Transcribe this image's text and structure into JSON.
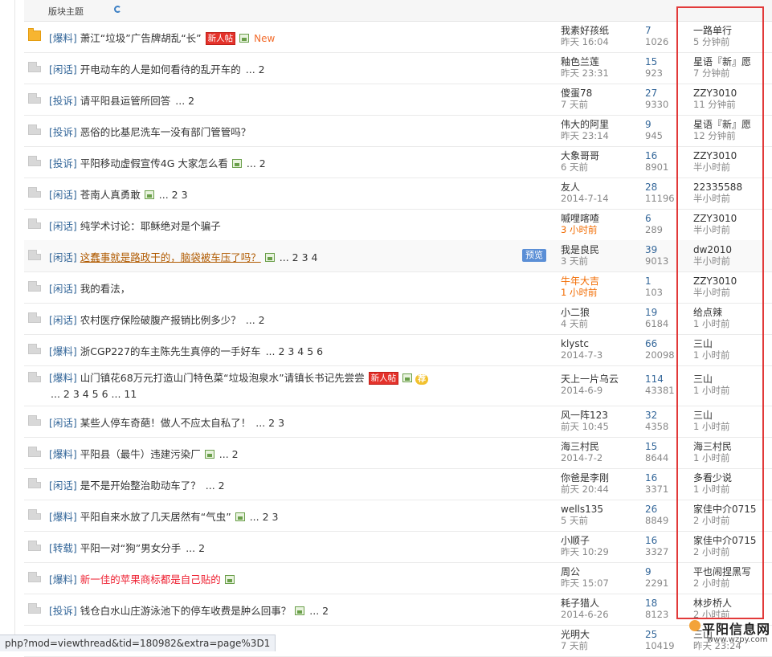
{
  "header": {
    "title": "版块主题"
  },
  "rows": [
    {
      "icon": "hot",
      "cat": "[爆料]",
      "title": "萧江“垃圾”广告牌胡乱“长”",
      "tags": [
        "newpost",
        "img",
        "newtext"
      ],
      "pages": "",
      "author": "我素好孩纸",
      "date": "昨天 16:04",
      "replies": "7",
      "views": "1026",
      "last_name": "一路单行",
      "last_time": "5 分钟前"
    },
    {
      "icon": "normal",
      "cat": "[闲话]",
      "title": "开电动车的人是如何看待的乱开车的",
      "tags": [],
      "pages": "... 2",
      "author": "釉色兰莲",
      "date": "昨天 23:31",
      "replies": "15",
      "views": "923",
      "last_name": "星语『新』愿",
      "last_time": "7 分钟前"
    },
    {
      "icon": "normal",
      "cat": "[投诉]",
      "title": "请平阳县运管所回答",
      "tags": [],
      "pages": "... 2",
      "author": "傻蛋78",
      "date": "7 天前",
      "replies": "27",
      "views": "9330",
      "last_name": "ZZY3010",
      "last_time": "11 分钟前"
    },
    {
      "icon": "normal",
      "cat": "[投诉]",
      "title": "恶俗的比基尼洗车一没有部门管管吗？",
      "tags": [],
      "pages": "",
      "author": "伟大的阿里",
      "date": "昨天 23:14",
      "replies": "9",
      "views": "945",
      "last_name": "星语『新』愿",
      "last_time": "12 分钟前"
    },
    {
      "icon": "normal",
      "cat": "[投诉]",
      "title": "平阳移动虚假宣传4G 大家怎么看",
      "tags": [
        "img"
      ],
      "pages": "... 2",
      "author": "大象哥哥",
      "date": "6 天前",
      "replies": "16",
      "views": "8901",
      "last_name": "ZZY3010",
      "last_time": "半小时前"
    },
    {
      "icon": "normal",
      "cat": "[闲话]",
      "title": "苍南人真勇敢",
      "tags": [
        "img"
      ],
      "pages": "... 2  3",
      "author": "友人",
      "date": "2014-7-14",
      "replies": "28",
      "views": "11196",
      "last_name": "22335588",
      "last_time": "半小时前"
    },
    {
      "icon": "normal",
      "cat": "[闲话]",
      "title": "纯学术讨论：耶稣绝对是个骗子",
      "tags": [],
      "pages": "",
      "author": "嘁哩喀喳",
      "date": "3 小时前",
      "date_orange": true,
      "replies": "6",
      "views": "289",
      "last_name": "ZZY3010",
      "last_time": "半小时前"
    },
    {
      "icon": "normal",
      "cat": "[闲话]",
      "title": "这蠢事就是路政干的，脑袋被车压了吗？",
      "style": "link",
      "tags": [
        "img"
      ],
      "pages": "... 2  3  4",
      "preview": "预览",
      "author": "我是良民",
      "date": "3 天前",
      "replies": "39",
      "views": "9013",
      "last_name": "dw2010",
      "last_time": "半小时前"
    },
    {
      "icon": "normal",
      "cat": "[闲话]",
      "title": "我的看法，",
      "tags": [],
      "pages": "",
      "author": "牛年大吉",
      "date": "1 小时前",
      "date_orange": true,
      "author_orange": true,
      "replies": "1",
      "views": "103",
      "last_name": "ZZY3010",
      "last_time": "半小时前"
    },
    {
      "icon": "normal",
      "cat": "[闲话]",
      "title": "农村医疗保险破腹产报销比例多少？",
      "tags": [],
      "pages": "... 2",
      "author": "小二狼",
      "date": "4 天前",
      "replies": "19",
      "views": "6184",
      "last_name": "给点辣",
      "last_time": "1 小时前"
    },
    {
      "icon": "normal",
      "cat": "[爆料]",
      "title": "浙CGP227的车主陈先生真停的一手好车",
      "tags": [],
      "pages": "... 2  3  4  5  6",
      "author": "klystc",
      "date": "2014-7-3",
      "replies": "66",
      "views": "20098",
      "last_name": "三山",
      "last_time": "1 小时前"
    },
    {
      "icon": "normal",
      "cat": "[爆料]",
      "title": "山门镇花68万元打造山门特色菜“垃圾泡泉水”请镇长书记先尝尝",
      "tags": [
        "newpost",
        "img",
        "rec"
      ],
      "pages2": "... 2  3  4  5  6 ... 11",
      "author": "天上一片乌云",
      "date": "2014-6-9",
      "replies": "114",
      "views": "43381",
      "last_name": "三山",
      "last_time": "1 小时前"
    },
    {
      "icon": "normal",
      "cat": "[闲话]",
      "title": "某些人停车奇葩！做人不应太自私了！",
      "tags": [],
      "pages": "... 2  3",
      "author": "风一阵123",
      "date": "前天 10:45",
      "replies": "32",
      "views": "4358",
      "last_name": "三山",
      "last_time": "1 小时前"
    },
    {
      "icon": "normal",
      "cat": "[爆料]",
      "title": "平阳县（最牛）违建污染厂",
      "tags": [
        "img"
      ],
      "pages": "... 2",
      "author": "海三村民",
      "date": "2014-7-2",
      "replies": "15",
      "views": "8644",
      "last_name": "海三村民",
      "last_time": "1 小时前"
    },
    {
      "icon": "normal",
      "cat": "[闲话]",
      "title": "是不是开始整治助动车了？",
      "tags": [],
      "pages": "... 2",
      "author": "你爸是李刚",
      "date": "前天 20:44",
      "replies": "16",
      "views": "3371",
      "last_name": "多看少说",
      "last_time": "1 小时前"
    },
    {
      "icon": "normal",
      "cat": "[爆料]",
      "title": "平阳自来水放了几天居然有“气虫”",
      "tags": [
        "img"
      ],
      "pages": "... 2  3",
      "author": "wells135",
      "date": "5 天前",
      "replies": "26",
      "views": "8849",
      "last_name": "家佳中介0715",
      "last_time": "2 小时前"
    },
    {
      "icon": "normal",
      "cat": "[转载]",
      "title": "平阳一对“狗”男女分手",
      "tags": [],
      "pages": "... 2",
      "author": "小顺子",
      "date": "昨天 10:29",
      "replies": "16",
      "views": "3327",
      "last_name": "家佳中介0715",
      "last_time": "2 小时前"
    },
    {
      "icon": "normal",
      "cat": "[爆料]",
      "title": "新一佳的苹果商标都是自己贴的",
      "style": "red",
      "tags": [
        "img"
      ],
      "pages": "",
      "author": "周公",
      "date": "昨天 15:07",
      "replies": "9",
      "views": "2291",
      "last_name": "平也闹捏黑写",
      "last_time": "2 小时前"
    },
    {
      "icon": "normal",
      "cat": "[投诉]",
      "title": "钱仓白水山庄游泳池下的停车收费是肿么回事？",
      "tags": [
        "img"
      ],
      "pages": "... 2",
      "author": "耗子猎人",
      "date": "2014-6-26",
      "replies": "18",
      "views": "8123",
      "last_name": "林步桥人",
      "last_time": "2 小时前"
    },
    {
      "icon": "normal",
      "cat": "",
      "title": "",
      "tags": [],
      "pages": "... 2  3",
      "author": "光明大",
      "date": "7 天前",
      "replies": "25",
      "views": "10419",
      "last_name": "三山",
      "last_time": "昨天 23:24"
    }
  ],
  "labels": {
    "newpost": "新人帖",
    "newtext": "New",
    "rec": "荐"
  },
  "status_url": "php?mod=viewthread&tid=180982&extra=page%3D1",
  "watermark": {
    "name": "平阳信息网",
    "url": "www.wzpy.com"
  }
}
